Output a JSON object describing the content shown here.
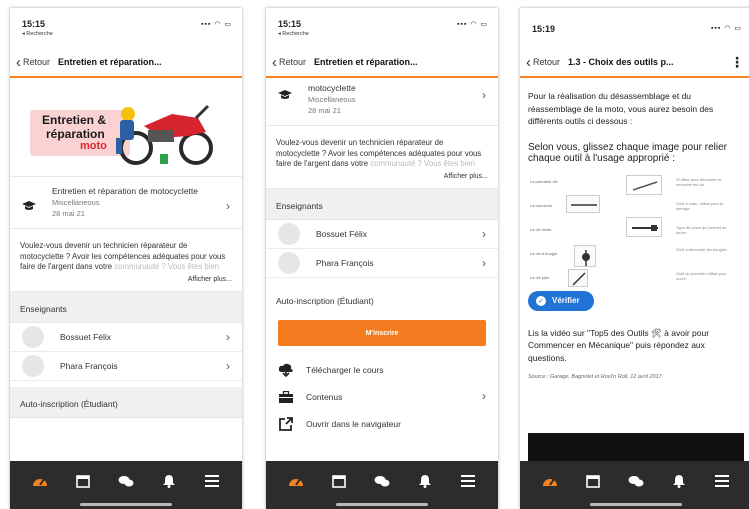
{
  "screens": [
    {
      "status": {
        "time": "15:15",
        "back_app": "◂ Recherche",
        "icons": "▪▪▪ ◠ ▭"
      },
      "nav": {
        "back_label": "Retour",
        "title": "Entretien et réparation..."
      },
      "banner": {
        "line1": "Entretien &",
        "line2": "réparation",
        "line3": "moto"
      },
      "course": {
        "name": "Entretien et réparation de motocyclette",
        "category": "Miscellaneous",
        "date": "28 mai 21"
      },
      "description": {
        "text": "Voulez-vous devenir un technicien réparateur de motocyclette ? Avoir les compétences adéquates pour vous faire de l'argent dans votre",
        "faded": "communauté ? Vous êtes bien",
        "more": "Afficher plus..."
      },
      "teachers_title": "Enseignants",
      "teachers": [
        "Bossuet Félix",
        "Phara François"
      ],
      "enrol_title": "Auto-inscription (Étudiant)"
    },
    {
      "status": {
        "time": "15:15",
        "back_app": "◂ Recherche",
        "icons": "▪▪▪ ◠ ▭"
      },
      "nav": {
        "back_label": "Retour",
        "title": "Entretien et réparation..."
      },
      "course": {
        "name": "motocyclette",
        "category": "Miscellaneous",
        "date": "28 mai 21"
      },
      "description": {
        "text": "Voulez-vous devenir un technicien réparateur de motocyclette ? Avoir les compétences adéquates pour vous faire de l'argent dans votre",
        "faded": "communauté ? Vous êtes bien",
        "more": "Afficher plus..."
      },
      "teachers_title": "Enseignants",
      "teachers": [
        "Bossuet Félix",
        "Phara François"
      ],
      "enrol_title": "Auto-inscription (Étudiant)",
      "enrol_button": "M'inscrire",
      "actions": [
        "Télécharger le cours",
        "Contenus",
        "Ouvrir dans le navigateur"
      ]
    },
    {
      "status": {
        "time": "15:19",
        "icons": "▪▪▪ ◠ ▭"
      },
      "nav": {
        "back_label": "Retour",
        "title": "1.3 - Choix des outils p...",
        "more": "⋮"
      },
      "intro": "Pour la réalisation du désassemblage et du réassemblage de la moto, vous aurez besoin des différents outils ci dessous :",
      "question": "Selon vous, glissez chaque image pour relier chaque outil à l'usage approprié :",
      "exercise_labels": [
        "La première clé",
        "La tournevis",
        "La clé mixte",
        "La clé à bougie",
        "La clé pipe"
      ],
      "exercise_descs": [
        "S'utilise pour démonter et remonter les vis",
        "Outil à main, utilisé pour le serrage",
        "Type de pince qui permet de tordre",
        "Outil à démonter les bougies",
        "Outil du plombier utilisé pour ouvrir"
      ],
      "verify": "Vérifier",
      "video_text": "Lis la vidéo sur \"Top5 des Outils 🛠 à avoir pour Commencer en Mécanique\" puis répondez aux questions.",
      "source": "Source : Garage, Bagnolet et Roul'n Roll, 12 avril 2017"
    }
  ],
  "colors": {
    "accent": "#f58220",
    "tabbar": "#2c2c2c",
    "verify": "#1f74d6",
    "banner_red": "#e3262f"
  }
}
